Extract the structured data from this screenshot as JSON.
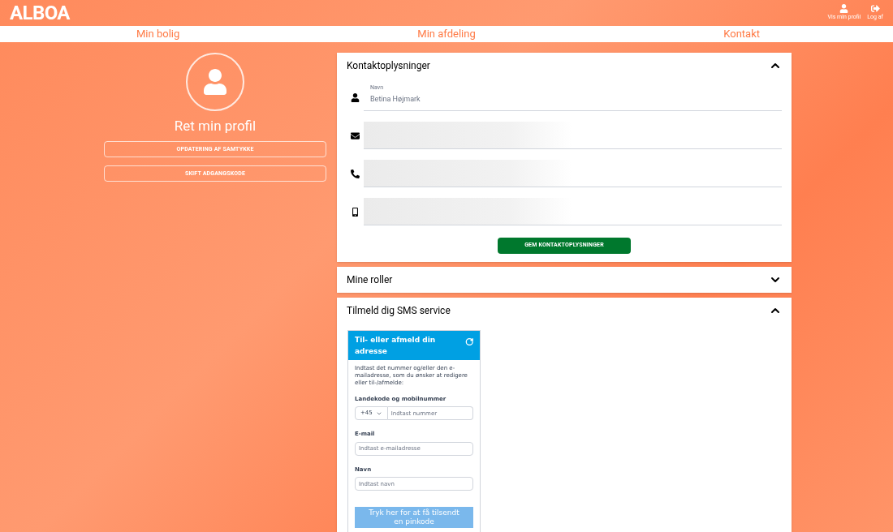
{
  "header": {
    "logo": "ALBOA",
    "actions": [
      {
        "kind": "profile",
        "label": "Vis min profil"
      },
      {
        "kind": "logout",
        "label": "Log af"
      }
    ]
  },
  "nav": [
    {
      "label": "Min bolig"
    },
    {
      "label": "Min afdeling"
    },
    {
      "label": "Kontakt"
    }
  ],
  "profile": {
    "title": "Ret min profil",
    "buttons": [
      "OPDATERING AF SAMTYKKE",
      "SKIFT ADGANGSKODE"
    ]
  },
  "contact": {
    "title": "Kontaktoplysninger",
    "expanded": true,
    "fields": [
      {
        "kind": "person",
        "label": "Navn",
        "value": "Betina Højmark",
        "blurred": false
      },
      {
        "kind": "mail",
        "blurred": true
      },
      {
        "kind": "phone",
        "blurred": true
      },
      {
        "kind": "mobile",
        "blurred": true
      }
    ],
    "save": "GEM KONTAKTOPLYSNINGER"
  },
  "roles": {
    "title": "Mine roller",
    "expanded": false
  },
  "sms": {
    "title": "Tilmeld dig SMS service",
    "expanded": true,
    "card": {
      "title": "Til- eller afmeld din adresse",
      "intro": "Indtast det nummer og/eller den e-mailadresse, som du ønsker at redigere eller til-/afmelde:",
      "phone_label": "Landekode og mobilnummer",
      "country_code": "+45",
      "phone_placeholder": "Indtast nummer",
      "email_label": "E-mail",
      "email_placeholder": "Indtast e-mailadresse",
      "name_label": "Navn",
      "name_placeholder": "Indtast navn",
      "submit": "Tryk her for at få tilsendt en pinkode"
    }
  }
}
